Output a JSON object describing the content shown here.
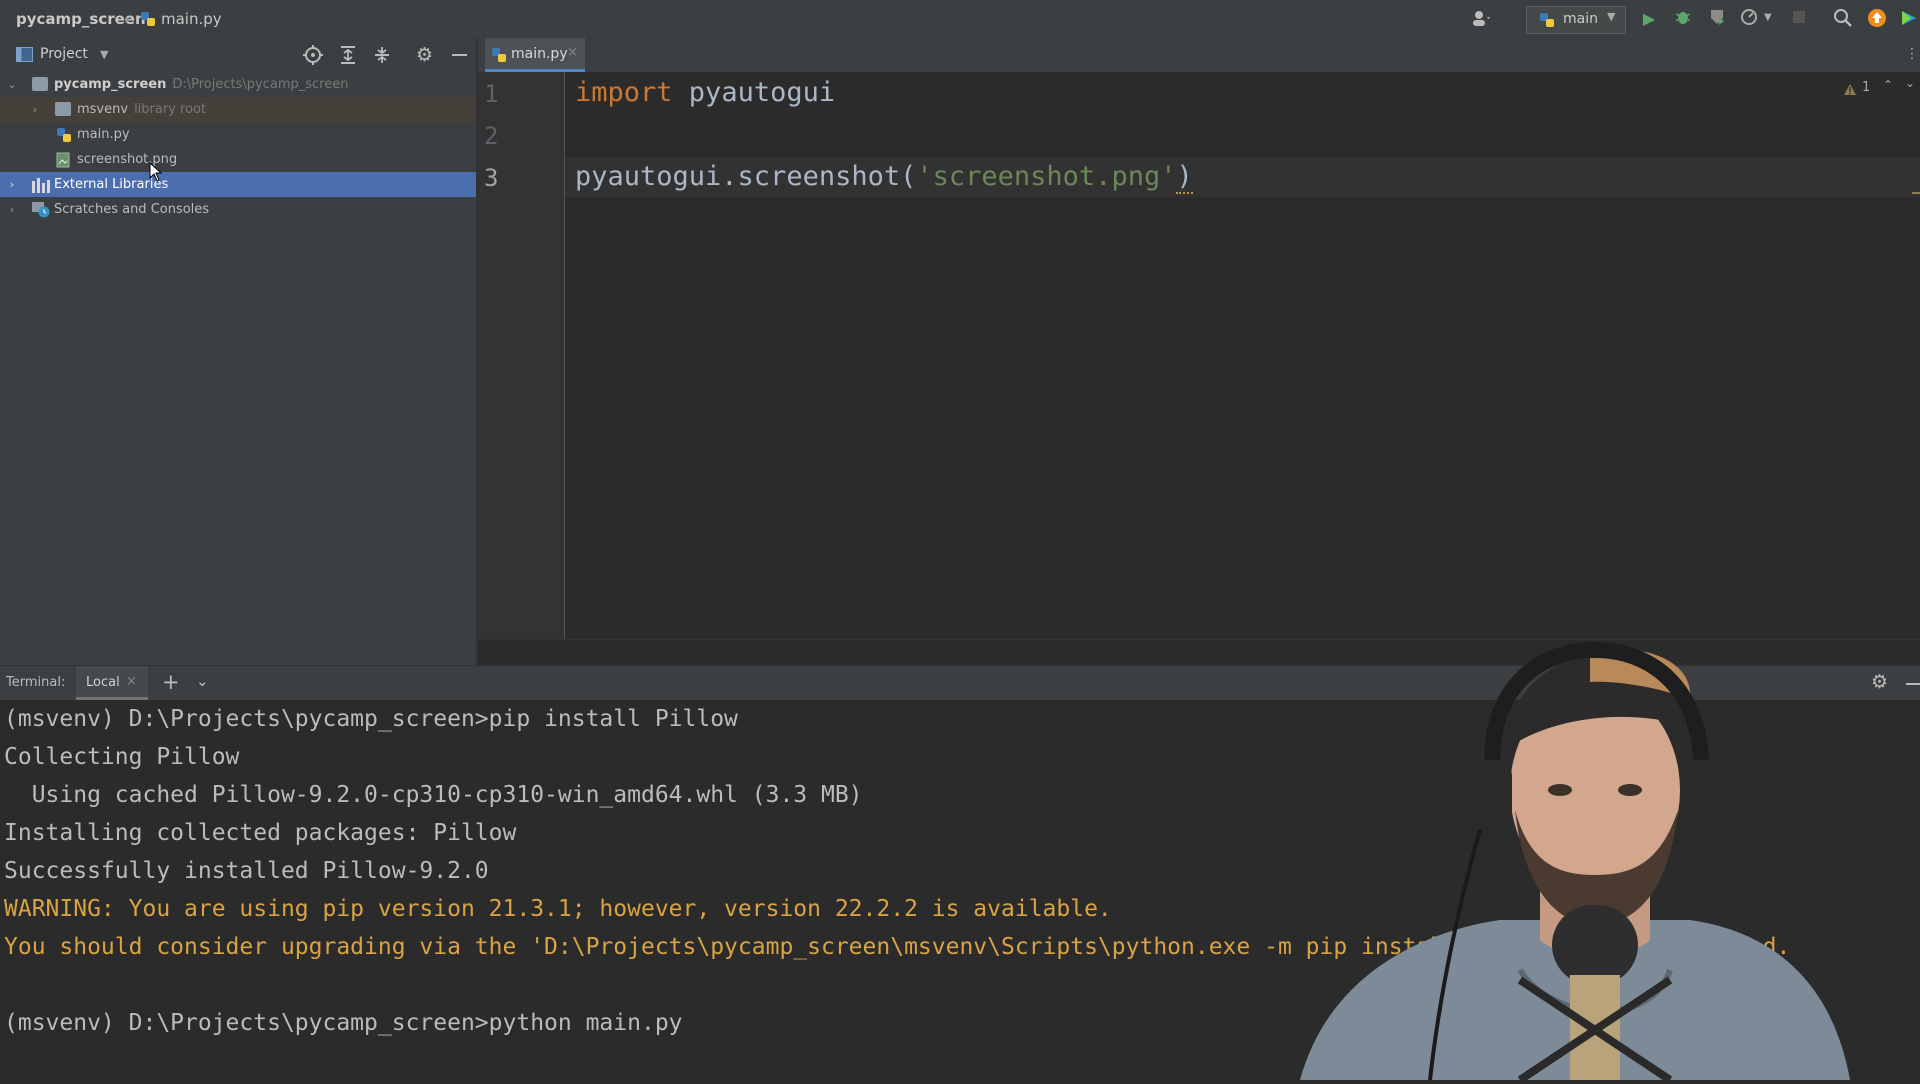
{
  "titlebar": {
    "project_name": "pycamp_screen",
    "file_name": "main.py",
    "run_config": "main",
    "icons": [
      "account-icon",
      "python-icon",
      "run-icon",
      "debug-icon",
      "coverage-icon",
      "profile-icon",
      "stop-icon",
      "search-icon",
      "update-icon",
      "toolbox-icon"
    ]
  },
  "project_panel": {
    "title": "Project",
    "tree": [
      {
        "label": "pycamp_screen",
        "hint": "D:\\Projects\\pycamp_screen"
      },
      {
        "label": "msvenv",
        "hint": "library root"
      },
      {
        "label": "main.py",
        "hint": ""
      },
      {
        "label": "screenshot.png",
        "hint": ""
      },
      {
        "label": "External Libraries",
        "hint": ""
      },
      {
        "label": "Scratches and Consoles",
        "hint": ""
      }
    ]
  },
  "editor": {
    "tab_label": "main.py",
    "line_numbers": [
      "1",
      "2",
      "3"
    ],
    "line1_keyword": "import",
    "line1_rest": " pyautogui",
    "line3_prefix": "pyautogui.screenshot(",
    "line3_string": "'screenshot.png'",
    "line3_suffix": ")",
    "warning_count": "1"
  },
  "terminal": {
    "label": "Terminal:",
    "tab_label": "Local",
    "lines": [
      "(msvenv) D:\\Projects\\pycamp_screen>pip install Pillow",
      "Collecting Pillow",
      "  Using cached Pillow-9.2.0-cp310-cp310-win_amd64.whl (3.3 MB)",
      "Installing collected packages: Pillow",
      "Successfully installed Pillow-9.2.0",
      "WARNING: You are using pip version 21.3.1; however, version 22.2.2 is available.",
      "You should consider upgrading via the 'D:\\Projects\\pycamp_screen\\msvenv\\Scripts\\python.exe -m pip install --upgrade pip' command.",
      "",
      "(msvenv) D:\\Projects\\pycamp_screen>python main.py"
    ]
  },
  "colors": {
    "keyword": "#cc7832",
    "string": "#6a8759",
    "warning": "#d9a343",
    "selection": "#4b6eaf"
  }
}
